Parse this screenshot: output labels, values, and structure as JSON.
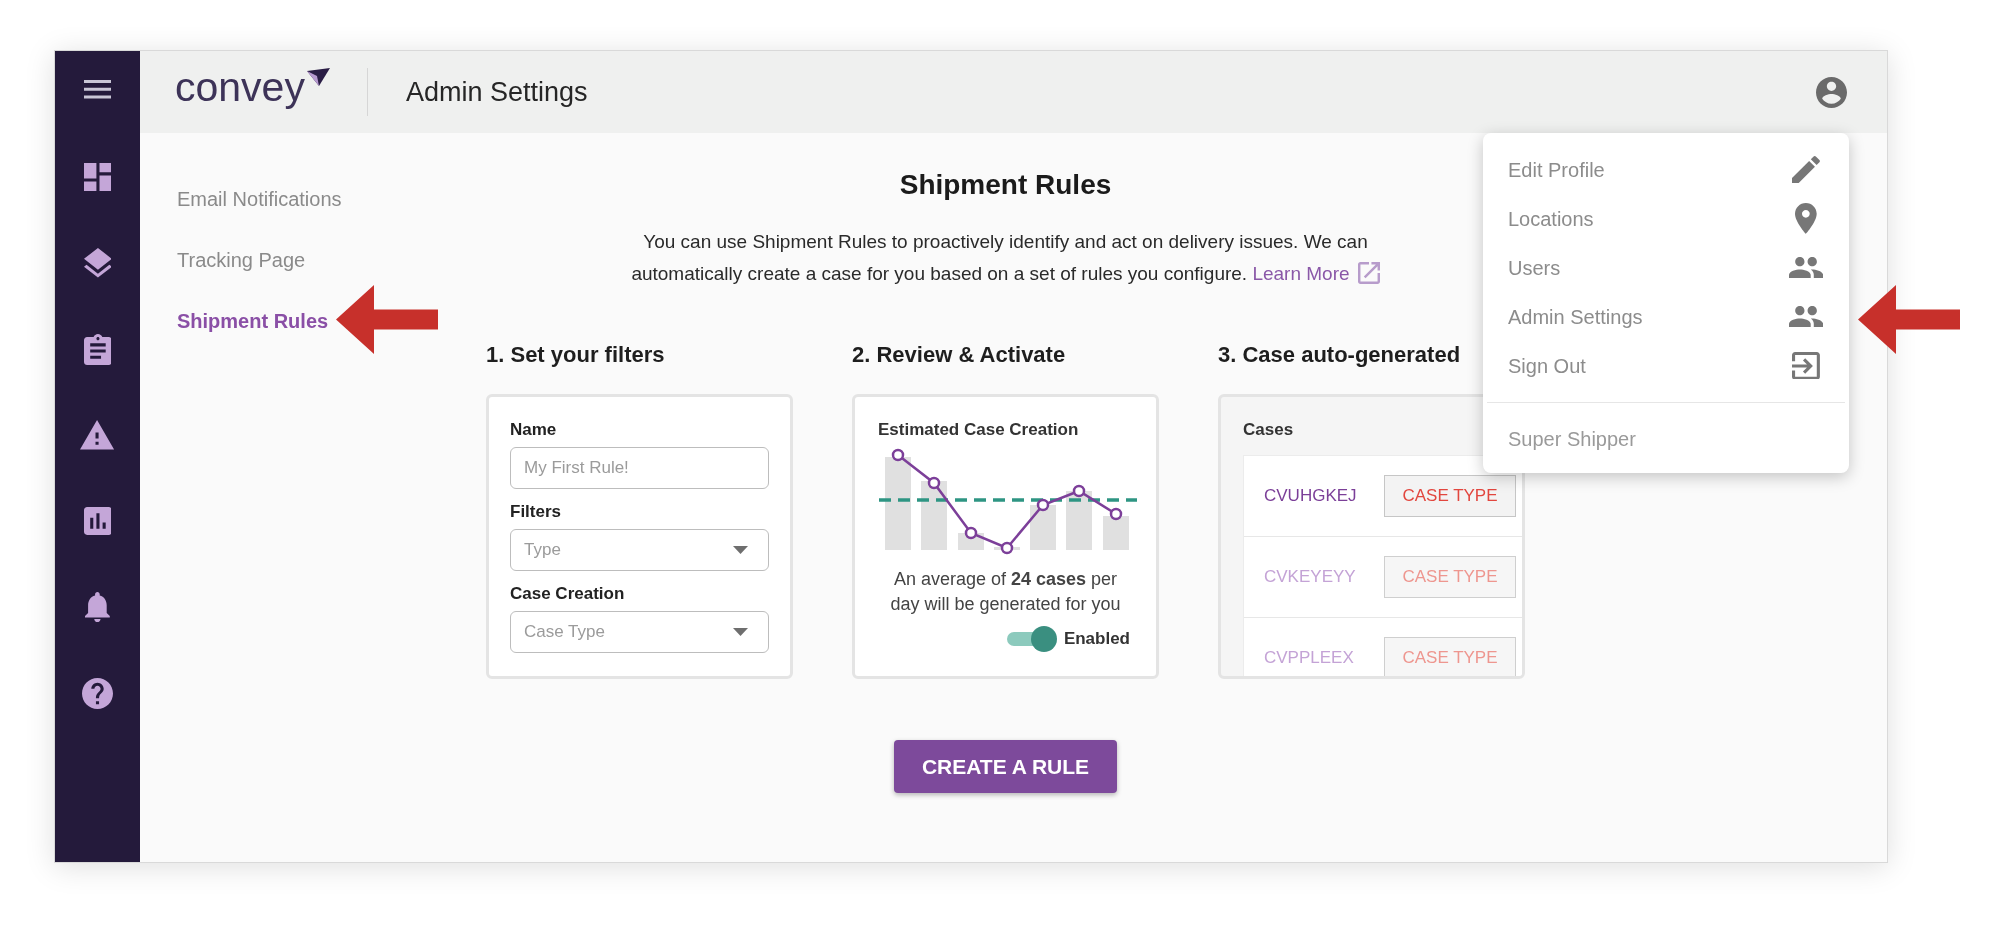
{
  "header": {
    "logo": "convey",
    "title": "Admin Settings"
  },
  "settings_nav": [
    {
      "label": "Email Notifications",
      "selected": false
    },
    {
      "label": "Tracking Page",
      "selected": false
    },
    {
      "label": "Shipment Rules",
      "selected": true
    }
  ],
  "intro": {
    "title": "Shipment Rules",
    "description": "You can use Shipment Rules to proactively identify and act on delivery issues. We can automatically create a case for you based on a set of rules you configure.",
    "link": "Learn More"
  },
  "steps": [
    {
      "kind": "filters",
      "heading": "1. Set your filters",
      "fields": [
        {
          "kind": "text",
          "label": "Name",
          "placeholder": "My First Rule!"
        },
        {
          "kind": "select",
          "label": "Filters",
          "placeholder": "Type"
        },
        {
          "kind": "select",
          "label": "Case Creation",
          "placeholder": "Case Type"
        }
      ]
    },
    {
      "kind": "review",
      "heading": "2. Review & Activate",
      "chart_title": "Estimated Case Creation",
      "summary": "An average of **24 cases** per day will be generated for you",
      "toggle": {
        "label": "Enabled",
        "on": true
      }
    },
    {
      "kind": "cases",
      "heading": "3. Case auto-generated",
      "list_title": "Cases",
      "cases": [
        {
          "id": "CVUHGKEJ",
          "type": "CASE TYPE",
          "dimmed": false
        },
        {
          "id": "CVKEYEYY",
          "type": "CASE TYPE",
          "dimmed": true
        },
        {
          "id": "CVPPLEEX",
          "type": "CASE TYPE",
          "dimmed": true
        }
      ]
    }
  ],
  "create_button": "CREATE A RULE",
  "user_menu": {
    "items": [
      {
        "label": "Edit Profile"
      },
      {
        "label": "Locations"
      },
      {
        "label": "Users"
      },
      {
        "label": "Admin Settings"
      },
      {
        "label": "Sign Out"
      }
    ],
    "account": "Super Shipper"
  }
}
